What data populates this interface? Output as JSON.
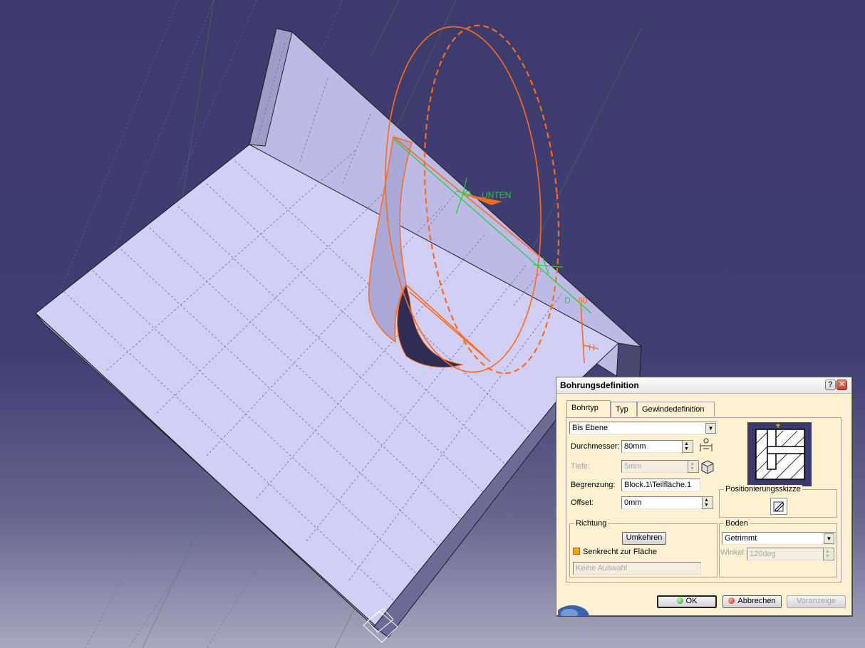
{
  "viewport": {
    "annotations": {
      "unten": "UNTEN",
      "d_label": "D",
      "d_value": "80",
      "h_label": "H"
    }
  },
  "dialog": {
    "title": "Bohrungsdefinition",
    "help_glyph": "?",
    "close_glyph": "✕",
    "tabs": [
      {
        "label": "Bohrtyp",
        "active": true
      },
      {
        "label": "Typ",
        "active": false
      },
      {
        "label": "Gewindedefinition",
        "active": false
      }
    ],
    "limit_type": {
      "selected": "Bis Ebene"
    },
    "diameter": {
      "label": "Durchmesser:",
      "value": "80mm"
    },
    "depth": {
      "label": "Tiefe:",
      "value": "5mm",
      "enabled": false
    },
    "limit": {
      "label": "Begrenzung:",
      "value": "Block.1\\Teilfläche.1"
    },
    "offset": {
      "label": "Offset:",
      "value": "0mm"
    },
    "positioning_sketch": {
      "label": "Positionierungsskizze"
    },
    "direction": {
      "label": "Richtung",
      "reverse_button": "Umkehren",
      "normal_to_surface": {
        "label": "Senkrecht zur Fläche",
        "checked": true
      },
      "selection_placeholder": "Keine Auswahl"
    },
    "bottom": {
      "label": "Boden",
      "selected": "Getrimmt",
      "angle": {
        "label": "Winkel:",
        "value": "120deg",
        "enabled": false
      }
    },
    "buttons": {
      "ok": "OK",
      "cancel": "Abbrechen",
      "preview": "Voranzeige"
    }
  },
  "colors": {
    "background": "#3d3b6e",
    "part_face": "#cfcdf5",
    "hole_outline": "#ff6a1a",
    "axis": "#1fd03a",
    "dialog_bg": "#fdf1d2"
  }
}
